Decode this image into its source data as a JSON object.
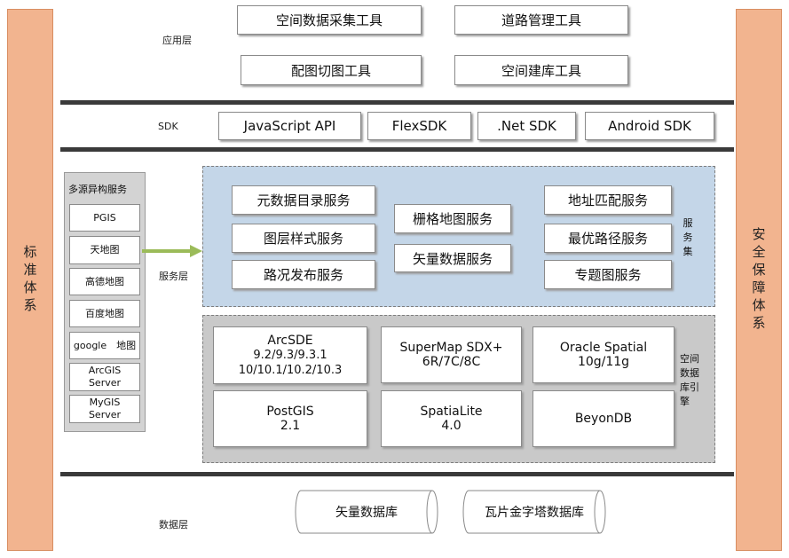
{
  "left_bar": "标准体系",
  "right_bar": "安全保障体系",
  "layers": {
    "app": "应用层",
    "sdk": "SDK",
    "service": "服务层",
    "data": "数据层"
  },
  "app_tools": [
    "空间数据采集工具",
    "道路管理工具",
    "配图切图工具",
    "空间建库工具"
  ],
  "sdk_items": [
    "JavaScript API",
    "FlexSDK",
    ".Net SDK",
    "Android SDK"
  ],
  "multi_source": {
    "title": "多源异构服务",
    "items": [
      "PGIS",
      "天地图",
      "高德地图",
      "百度地图",
      "google　地图",
      "ArcGIS Server",
      "MyGIS Server"
    ]
  },
  "services": {
    "col1": [
      "元数据目录服务",
      "图层样式服务",
      "路况发布服务"
    ],
    "col2": [
      "栅格地图服务",
      "矢量数据服务"
    ],
    "col3": [
      "地址匹配服务",
      "最优路径服务",
      "专题图服务"
    ],
    "label": "服务集"
  },
  "engines": {
    "arcsde": [
      "ArcSDE",
      "9.2/9.3/9.3.1",
      "10/10.1/10.2/10.3"
    ],
    "supermap": [
      "SuperMap SDX+",
      "6R/7C/8C"
    ],
    "oracle": [
      "Oracle Spatial",
      "10g/11g"
    ],
    "postgis": [
      "PostGIS",
      "2.1"
    ],
    "spatialite": [
      "SpatiaLite",
      "4.0"
    ],
    "beyondb": [
      "BeyonDB"
    ],
    "label": "空间数据库引擎"
  },
  "databases": [
    "矢量数据库",
    "瓦片金字塔数据库"
  ],
  "colors": {
    "side": "#f2b48f",
    "service_bg": "#c4d6e8",
    "engine_bg": "#c9c9c9",
    "arrow": "#9bbb59"
  }
}
